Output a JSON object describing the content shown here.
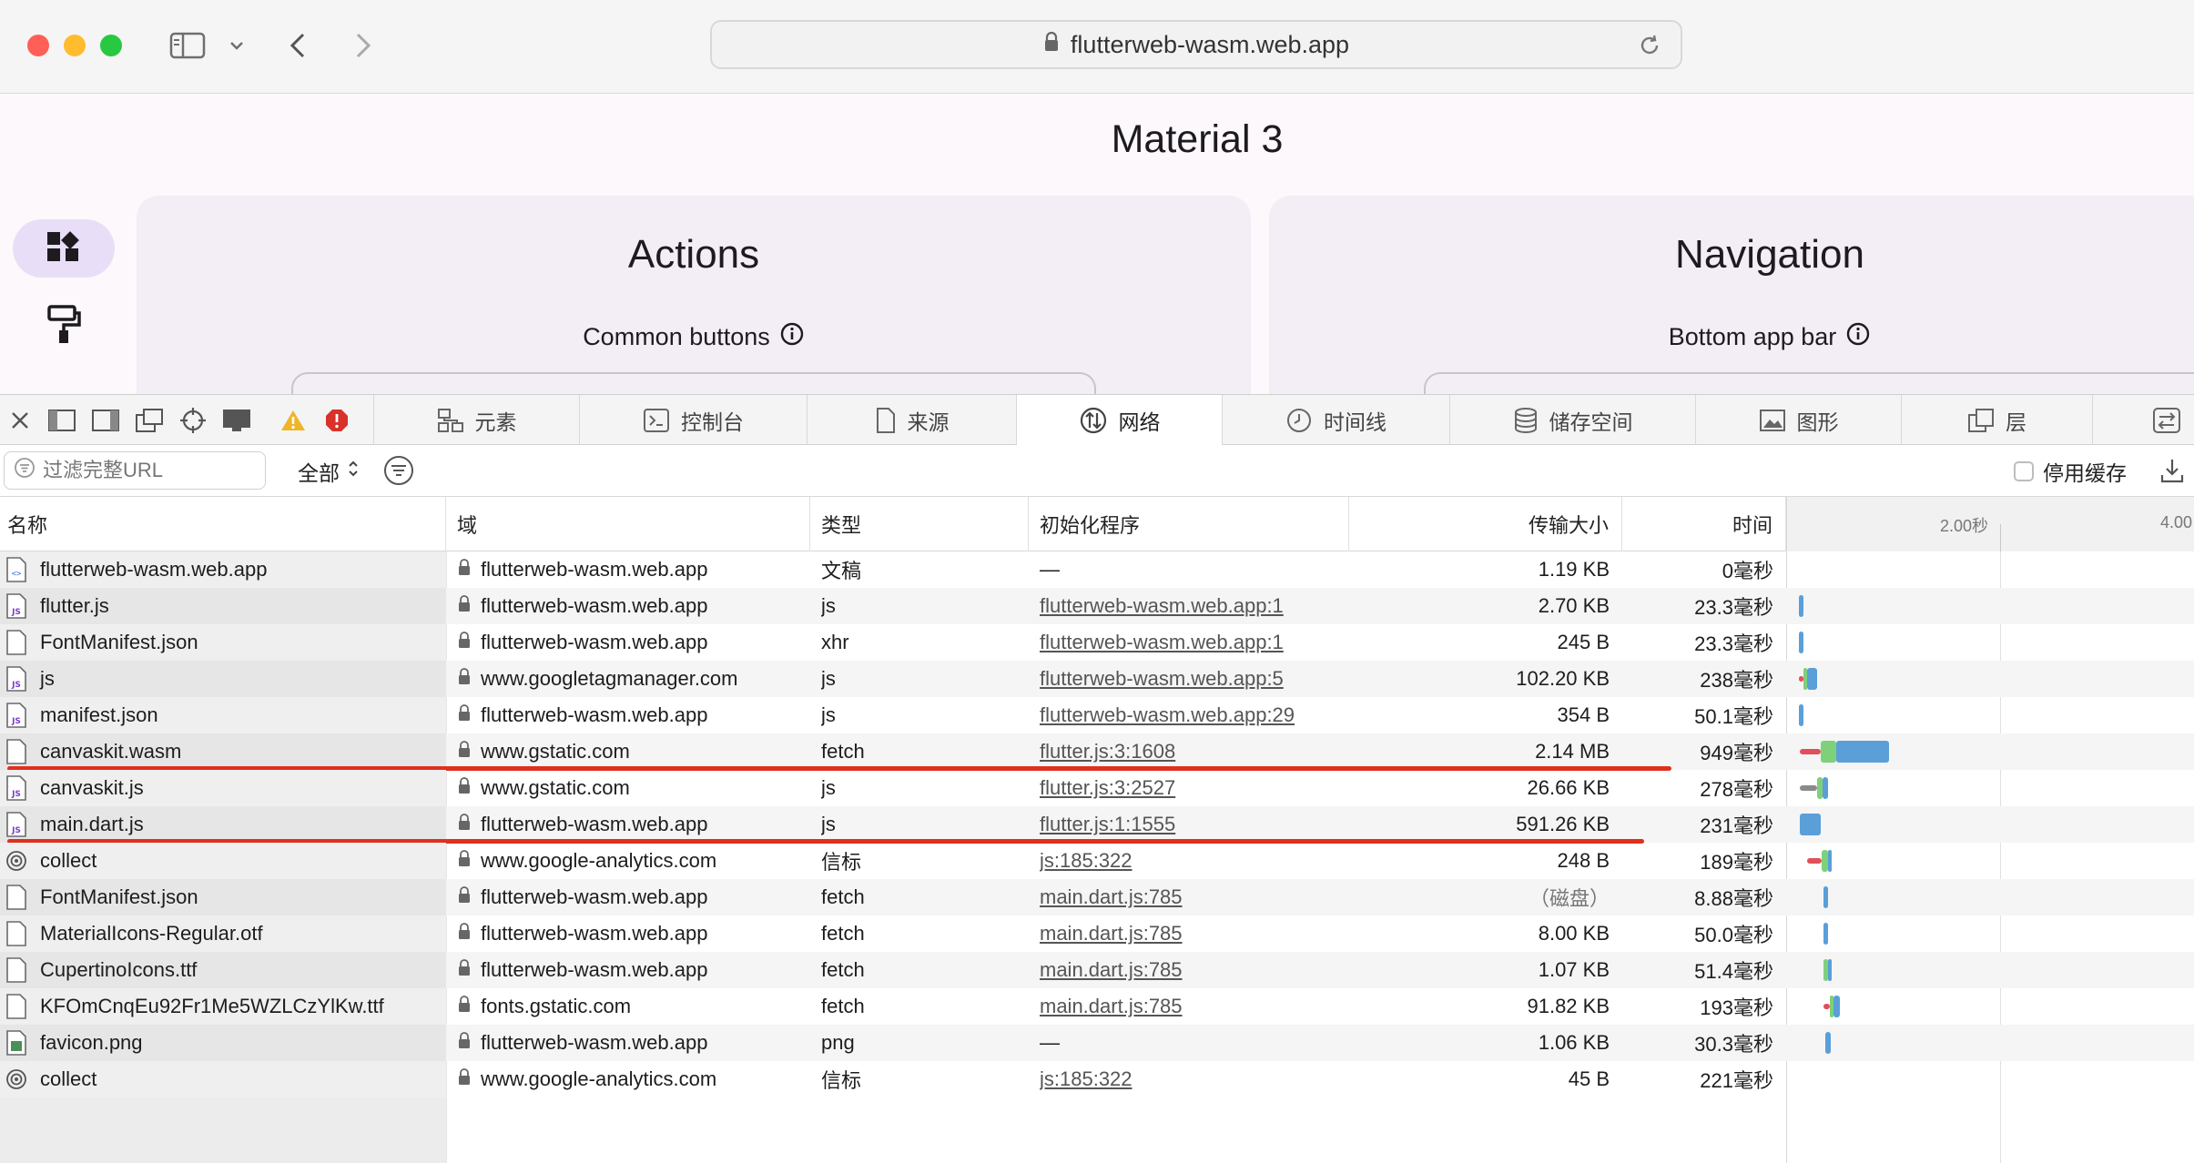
{
  "browser": {
    "url": "flutterweb-wasm.web.app"
  },
  "page": {
    "title": "Material 3",
    "cards": [
      {
        "title": "Actions",
        "subtitle": "Common buttons"
      },
      {
        "title": "Navigation",
        "subtitle": "Bottom app bar"
      }
    ]
  },
  "devtools": {
    "tabs": [
      {
        "label": "元素",
        "icon": "elements-icon"
      },
      {
        "label": "控制台",
        "icon": "console-icon"
      },
      {
        "label": "来源",
        "icon": "sources-icon"
      },
      {
        "label": "网络",
        "icon": "network-icon",
        "active": true
      },
      {
        "label": "时间线",
        "icon": "timeline-icon"
      },
      {
        "label": "储存空间",
        "icon": "storage-icon"
      },
      {
        "label": "图形",
        "icon": "graphics-icon"
      },
      {
        "label": "层",
        "icon": "layers-icon"
      }
    ],
    "filter": {
      "placeholder": "过滤完整URL",
      "type": "全部",
      "disable_cache": "停用缓存"
    },
    "columns": {
      "name": "名称",
      "domain": "域",
      "type": "类型",
      "initiator": "初始化程序",
      "size": "传输大小",
      "time": "时间"
    },
    "waterfall_ticks": [
      "2.00秒",
      "4.00"
    ],
    "requests": [
      {
        "name": "flutterweb-wasm.web.app",
        "icon": "html",
        "domain": "flutterweb-wasm.web.app",
        "type": "文稿",
        "initiator": "—",
        "initiator_link": false,
        "size": "1.19 KB",
        "time": "0毫秒",
        "bar": []
      },
      {
        "name": "flutter.js",
        "icon": "js",
        "domain": "flutterweb-wasm.web.app",
        "type": "js",
        "initiator": "flutterweb-wasm.web.app:1",
        "initiator_link": true,
        "size": "2.70 KB",
        "time": "23.3毫秒",
        "bar": [
          {
            "s": 0.02,
            "e": 0.06,
            "c": "#5a9fd8"
          }
        ]
      },
      {
        "name": "FontManifest.json",
        "icon": "doc",
        "domain": "flutterweb-wasm.web.app",
        "type": "xhr",
        "initiator": "flutterweb-wasm.web.app:1",
        "initiator_link": true,
        "size": "245 B",
        "time": "23.3毫秒",
        "bar": [
          {
            "s": 0.02,
            "e": 0.06,
            "c": "#5a9fd8"
          }
        ]
      },
      {
        "name": "js",
        "icon": "js",
        "domain": "www.googletagmanager.com",
        "type": "js",
        "initiator": "flutterweb-wasm.web.app:5",
        "initiator_link": true,
        "size": "102.20 KB",
        "time": "238毫秒",
        "bar": [
          {
            "s": 0.02,
            "e": 0.06,
            "c": "#e0505a"
          },
          {
            "s": 0.06,
            "e": 0.1,
            "c": "#7fd07a"
          },
          {
            "s": 0.1,
            "e": 0.2,
            "c": "#5a9fd8"
          }
        ]
      },
      {
        "name": "manifest.json",
        "icon": "js",
        "domain": "flutterweb-wasm.web.app",
        "type": "js",
        "initiator": "flutterweb-wasm.web.app:29",
        "initiator_link": true,
        "size": "354 B",
        "time": "50.1毫秒",
        "bar": [
          {
            "s": 0.02,
            "e": 0.06,
            "c": "#5a9fd8"
          }
        ]
      },
      {
        "name": "canvaskit.wasm",
        "icon": "doc",
        "domain": "www.gstatic.com",
        "type": "fetch",
        "initiator": "flutter.js:3:1608",
        "initiator_link": true,
        "size": "2.14 MB",
        "time": "949毫秒",
        "bar": [
          {
            "s": 0.03,
            "e": 0.23,
            "c": "#e0505a"
          },
          {
            "s": 0.23,
            "e": 0.38,
            "c": "#7fd07a"
          },
          {
            "s": 0.38,
            "e": 0.9,
            "c": "#5a9fd8"
          }
        ],
        "underline": 1836
      },
      {
        "name": "canvaskit.js",
        "icon": "js",
        "domain": "www.gstatic.com",
        "type": "js",
        "initiator": "flutter.js:3:2527",
        "initiator_link": true,
        "size": "26.66 KB",
        "time": "278毫秒",
        "bar": [
          {
            "s": 0.03,
            "e": 0.2,
            "c": "#8a8a8a"
          },
          {
            "s": 0.2,
            "e": 0.25,
            "c": "#7fd07a"
          },
          {
            "s": 0.25,
            "e": 0.3,
            "c": "#5a9fd8"
          }
        ]
      },
      {
        "name": "main.dart.js",
        "icon": "js",
        "domain": "flutterweb-wasm.web.app",
        "type": "js",
        "initiator": "flutter.js:1:1555",
        "initiator_link": true,
        "size": "591.26 KB",
        "time": "231毫秒",
        "bar": [
          {
            "s": 0.03,
            "e": 0.23,
            "c": "#5a9fd8"
          }
        ],
        "underline": 1806
      },
      {
        "name": "collect",
        "icon": "beacon",
        "domain": "www.google-analytics.com",
        "type": "信标",
        "initiator": "js:185:322",
        "initiator_link": true,
        "size": "248 B",
        "time": "189毫秒",
        "bar": [
          {
            "s": 0.1,
            "e": 0.24,
            "c": "#e0505a"
          },
          {
            "s": 0.24,
            "e": 0.3,
            "c": "#7fd07a"
          },
          {
            "s": 0.3,
            "e": 0.34,
            "c": "#5a9fd8"
          }
        ]
      },
      {
        "name": "FontManifest.json",
        "icon": "doc",
        "domain": "flutterweb-wasm.web.app",
        "type": "fetch",
        "initiator": "main.dart.js:785",
        "initiator_link": true,
        "size": "（磁盘）",
        "size_muted": true,
        "time": "8.88毫秒",
        "bar": [
          {
            "s": 0.26,
            "e": 0.3,
            "c": "#5a9fd8"
          }
        ]
      },
      {
        "name": "MaterialIcons-Regular.otf",
        "icon": "doc",
        "domain": "flutterweb-wasm.web.app",
        "type": "fetch",
        "initiator": "main.dart.js:785",
        "initiator_link": true,
        "size": "8.00 KB",
        "time": "50.0毫秒",
        "bar": [
          {
            "s": 0.26,
            "e": 0.3,
            "c": "#5a9fd8"
          }
        ]
      },
      {
        "name": "CupertinoIcons.ttf",
        "icon": "doc",
        "domain": "flutterweb-wasm.web.app",
        "type": "fetch",
        "initiator": "main.dart.js:785",
        "initiator_link": true,
        "size": "1.07 KB",
        "time": "51.4毫秒",
        "bar": [
          {
            "s": 0.26,
            "e": 0.3,
            "c": "#7fd07a"
          },
          {
            "s": 0.3,
            "e": 0.33,
            "c": "#5a9fd8"
          }
        ]
      },
      {
        "name": "KFOmCnqEu92Fr1Me5WZLCzYlKw.ttf",
        "icon": "doc",
        "domain": "fonts.gstatic.com",
        "type": "fetch",
        "initiator": "main.dart.js:785",
        "initiator_link": true,
        "size": "91.82 KB",
        "time": "193毫秒",
        "bar": [
          {
            "s": 0.26,
            "e": 0.32,
            "c": "#e0505a"
          },
          {
            "s": 0.32,
            "e": 0.36,
            "c": "#7fd07a"
          },
          {
            "s": 0.36,
            "e": 0.42,
            "c": "#5a9fd8"
          }
        ]
      },
      {
        "name": "favicon.png",
        "icon": "img",
        "domain": "flutterweb-wasm.web.app",
        "type": "png",
        "initiator": "—",
        "initiator_link": false,
        "size": "1.06 KB",
        "time": "30.3毫秒",
        "bar": [
          {
            "s": 0.28,
            "e": 0.33,
            "c": "#5a9fd8"
          }
        ]
      },
      {
        "name": "collect",
        "icon": "beacon",
        "domain": "www.google-analytics.com",
        "type": "信标",
        "initiator": "js:185:322",
        "initiator_link": true,
        "size": "45 B",
        "time": "221毫秒",
        "bar": []
      }
    ]
  }
}
